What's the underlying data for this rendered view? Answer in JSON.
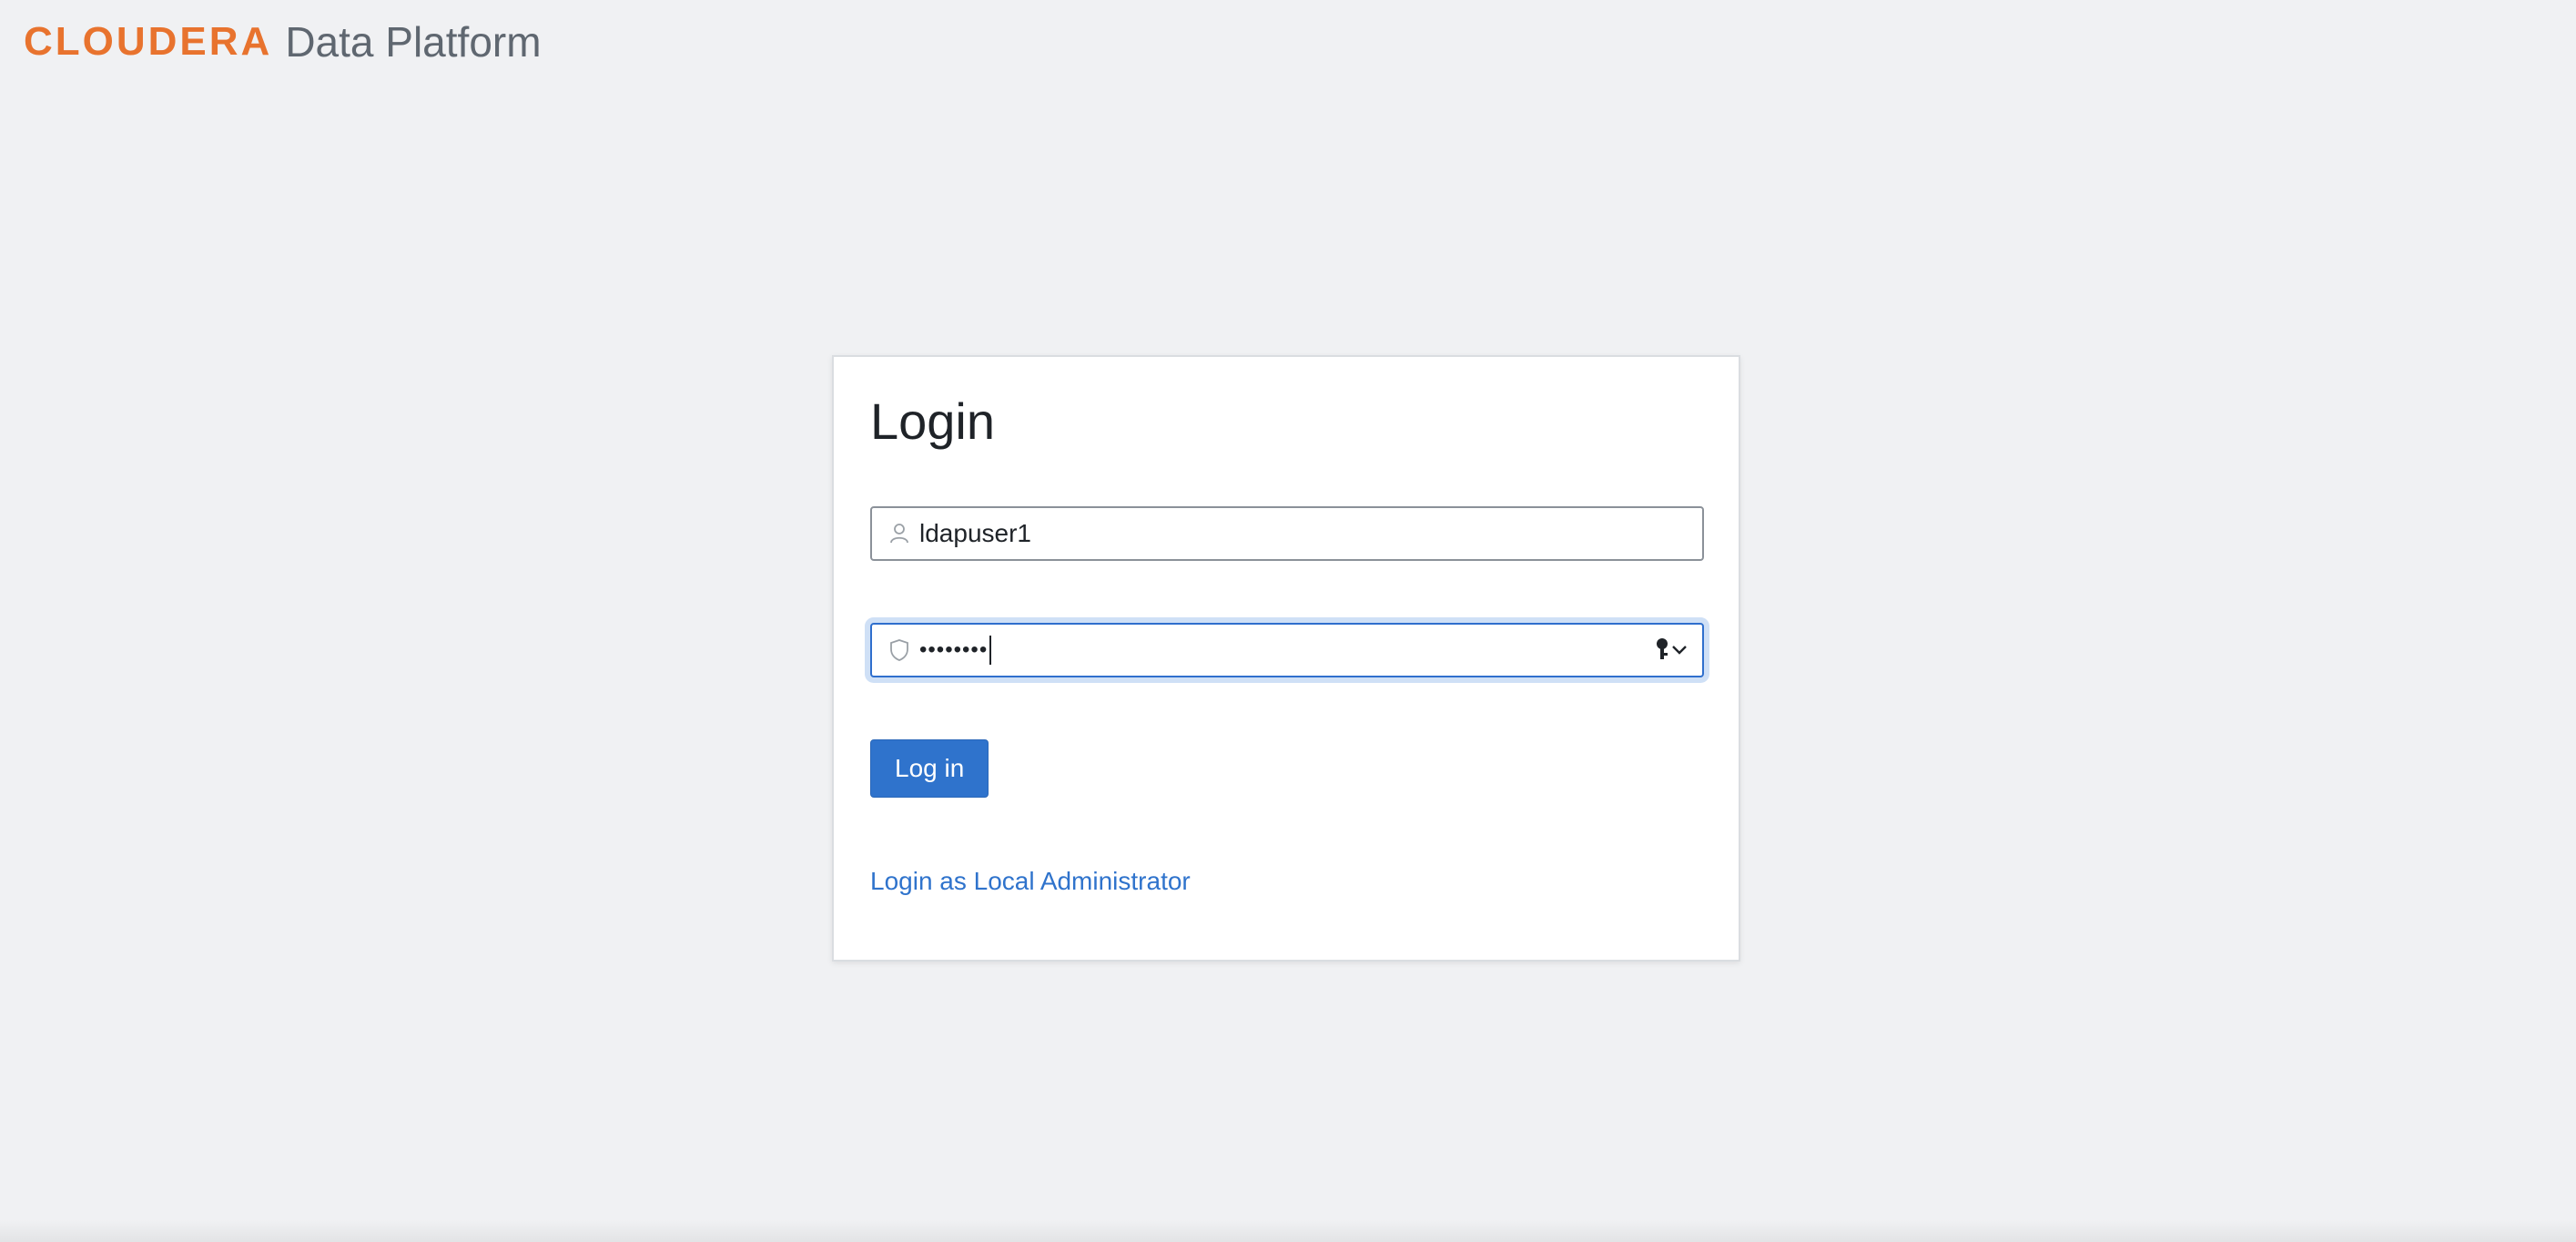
{
  "header": {
    "brand": "CLOUDERA",
    "product": "Data Platform"
  },
  "login": {
    "title": "Login",
    "username_value": "ldapuser1",
    "password_masked": "••••••••",
    "login_button": "Log in",
    "admin_link": "Login as Local Administrator"
  },
  "colors": {
    "brand": "#e8732e",
    "primary": "#2f73cc",
    "background": "#f0f1f3"
  },
  "icons": {
    "username": "user-icon",
    "password": "shield-icon",
    "password_manager": "key-icon"
  }
}
